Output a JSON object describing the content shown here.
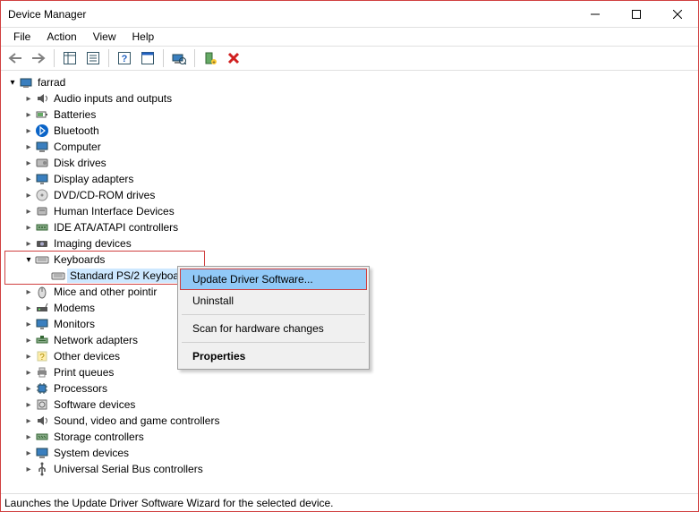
{
  "window": {
    "title": "Device Manager"
  },
  "menubar": {
    "file": "File",
    "action": "Action",
    "view": "View",
    "help": "Help"
  },
  "tree": {
    "root": "farrad",
    "items": [
      "Audio inputs and outputs",
      "Batteries",
      "Bluetooth",
      "Computer",
      "Disk drives",
      "Display adapters",
      "DVD/CD-ROM drives",
      "Human Interface Devices",
      "IDE ATA/ATAPI controllers",
      "Imaging devices",
      "Keyboards",
      "Mice and other pointir",
      "Modems",
      "Monitors",
      "Network adapters",
      "Other devices",
      "Print queues",
      "Processors",
      "Software devices",
      "Sound, video and game controllers",
      "Storage controllers",
      "System devices",
      "Universal Serial Bus controllers"
    ],
    "keyboard_child": "Standard PS/2 Keyboard"
  },
  "context_menu": {
    "update": "Update Driver Software...",
    "uninstall": "Uninstall",
    "scan": "Scan for hardware changes",
    "properties": "Properties"
  },
  "statusbar": "Launches the Update Driver Software Wizard for the selected device."
}
